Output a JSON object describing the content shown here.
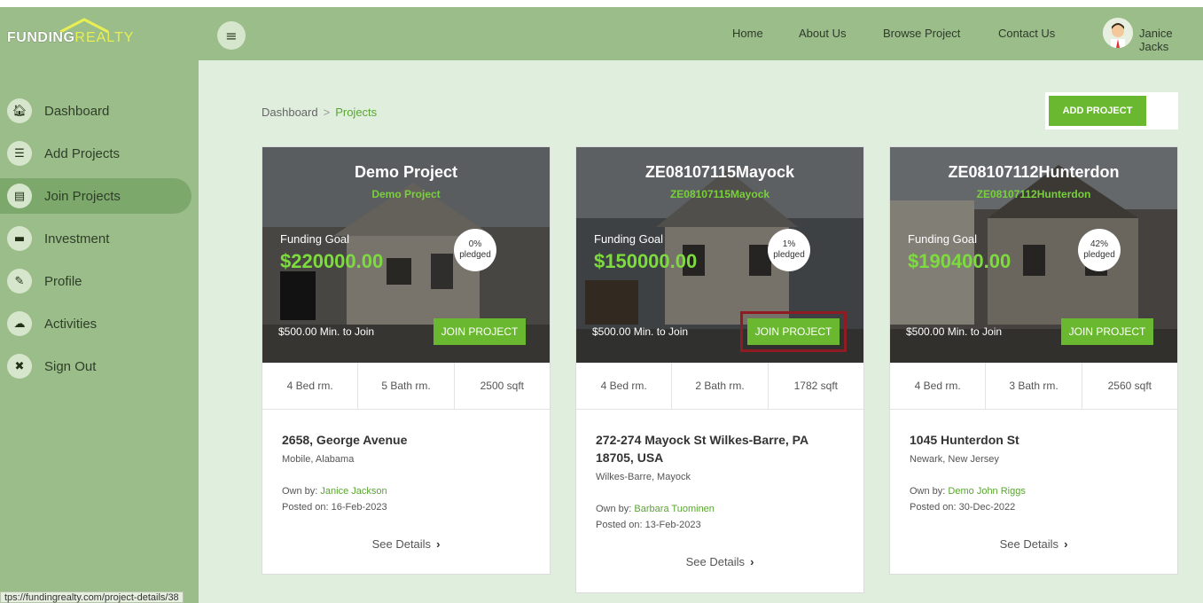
{
  "brand": {
    "logo_part1": "FUNDING",
    "logo_part2": "REALTY"
  },
  "nav": [
    "Home",
    "About Us",
    "Browse Project",
    "Contact Us"
  ],
  "user": {
    "name": "Janice Jacks"
  },
  "sidebar": {
    "items": [
      {
        "label": "Dashboard",
        "icon": "home-icon"
      },
      {
        "label": "Add Projects",
        "icon": "list-icon"
      },
      {
        "label": "Join Projects",
        "icon": "id-card-icon"
      },
      {
        "label": "Investment",
        "icon": "document-icon"
      },
      {
        "label": "Profile",
        "icon": "pencil-icon"
      },
      {
        "label": "Activities",
        "icon": "cloud-icon"
      },
      {
        "label": "Sign Out",
        "icon": "close-circle-icon"
      }
    ]
  },
  "breadcrumb": {
    "root": "Dashboard",
    "current": "Projects"
  },
  "add_project_label": "ADD PROJECT",
  "status_url": "tps://fundingrealty.com/project-details/38",
  "cards": [
    {
      "title": "Demo Project",
      "subtitle": "Demo Project",
      "funding_label": "Funding Goal",
      "funding_goal": "$220000.00",
      "pledged_pct": "0%",
      "pledged_label": "pledged",
      "min_join": "$500.00 Min. to Join",
      "join_label": "JOIN PROJECT",
      "beds": "4 Bed rm.",
      "baths": "5 Bath rm.",
      "sqft": "2500 sqft",
      "address": "2658, George Avenue",
      "city": "Mobile, Alabama",
      "owner_prefix": "Own by:",
      "owner": "Janice Jackson",
      "posted": "Posted on: 16-Feb-2023",
      "details_label": "See Details"
    },
    {
      "title": "ZE08107115Mayock",
      "subtitle": "ZE08107115Mayock",
      "funding_label": "Funding Goal",
      "funding_goal": "$150000.00",
      "pledged_pct": "1%",
      "pledged_label": "pledged",
      "min_join": "$500.00 Min. to Join",
      "join_label": "JOIN PROJECT",
      "beds": "4 Bed rm.",
      "baths": "2 Bath rm.",
      "sqft": "1782 sqft",
      "address": "272-274 Mayock St Wilkes-Barre, PA 18705, USA",
      "city": "Wilkes-Barre, Mayock",
      "owner_prefix": "Own by:",
      "owner": "Barbara Tuominen",
      "posted": "Posted on: 13-Feb-2023",
      "details_label": "See Details"
    },
    {
      "title": "ZE08107112Hunterdon",
      "subtitle": "ZE08107112Hunterdon",
      "funding_label": "Funding Goal",
      "funding_goal": "$190400.00",
      "pledged_pct": "42%",
      "pledged_label": "pledged",
      "min_join": "$500.00 Min. to Join",
      "join_label": "JOIN PROJECT",
      "beds": "4 Bed rm.",
      "baths": "3 Bath rm.",
      "sqft": "2560 sqft",
      "address": "1045 Hunterdon St",
      "city": "Newark, New Jersey",
      "owner_prefix": "Own by:",
      "owner": "Demo John Riggs",
      "posted": "Posted on: 30-Dec-2022",
      "details_label": "See Details"
    }
  ]
}
